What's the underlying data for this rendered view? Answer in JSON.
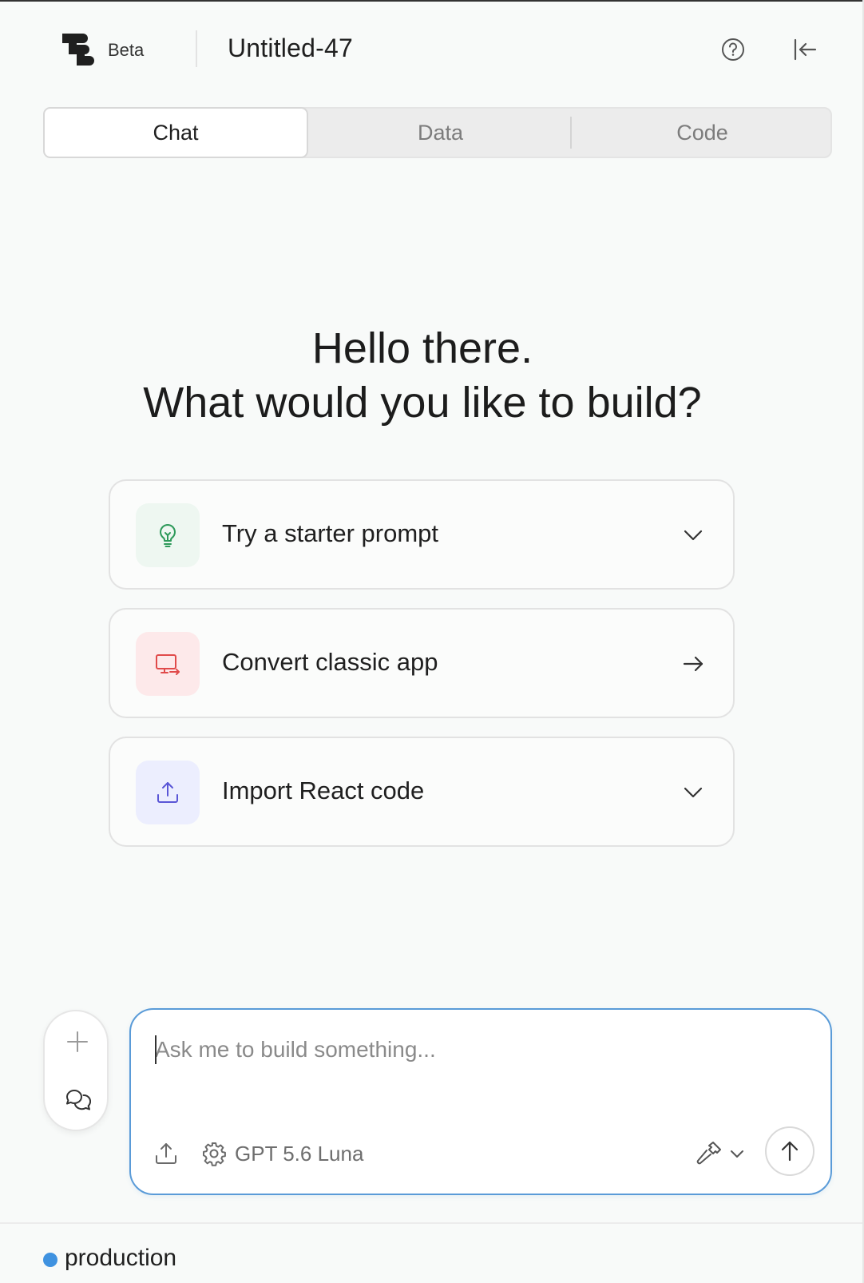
{
  "header": {
    "badge": "Beta",
    "doc_title": "Untitled-47"
  },
  "tabs": [
    {
      "label": "Chat",
      "active": true
    },
    {
      "label": "Data",
      "active": false
    },
    {
      "label": "Code",
      "active": false
    }
  ],
  "hero": {
    "line1": "Hello there.",
    "line2": "What would you like to build?"
  },
  "options": [
    {
      "label": "Try a starter prompt",
      "icon": "lightbulb-icon",
      "trailing": "chevron-down-icon",
      "accent": "#2e9a5a",
      "bg": "#eef7f1"
    },
    {
      "label": "Convert classic app",
      "icon": "monitor-convert-icon",
      "trailing": "arrow-right-icon",
      "accent": "#e04a4a",
      "bg": "#fde9ea"
    },
    {
      "label": "Import React code",
      "icon": "upload-icon",
      "trailing": "chevron-down-icon",
      "accent": "#5a56d6",
      "bg": "#eceefe"
    }
  ],
  "composer": {
    "placeholder": "Ask me to build something...",
    "value": "",
    "model": "GPT 5.6 Luna"
  },
  "footer": {
    "environment": "production",
    "env_color": "#3f92e0"
  },
  "colors": {
    "focus_border": "#5a9bd8",
    "background": "#f8faf9"
  }
}
